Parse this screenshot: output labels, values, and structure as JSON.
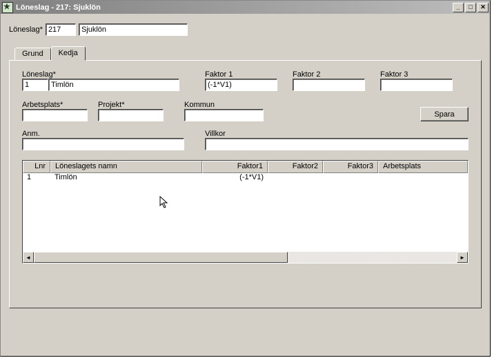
{
  "window": {
    "title": "Löneslag - 217: Sjuklön"
  },
  "header": {
    "loneslag_label": "Löneslag*",
    "loneslag_code": "217",
    "loneslag_name": "Sjuklön"
  },
  "tabs": {
    "grund": "Grund",
    "kedja": "Kedja"
  },
  "kedja": {
    "loneslag_label": "Löneslag*",
    "loneslag_code": "1",
    "loneslag_name": "Timlön",
    "faktor1_label": "Faktor 1",
    "faktor1_value": "(-1*V1)",
    "faktor2_label": "Faktor 2",
    "faktor2_value": "",
    "faktor3_label": "Faktor 3",
    "faktor3_value": "",
    "arbetsplats_label": "Arbetsplats*",
    "arbetsplats_value": "",
    "projekt_label": "Projekt*",
    "projekt_value": "",
    "kommun_label": "Kommun",
    "kommun_value": "",
    "spara_label": "Spara",
    "anm_label": "Anm.",
    "anm_value": "",
    "villkor_label": "Villkor",
    "villkor_value": ""
  },
  "table": {
    "headers": {
      "lnr": "Lnr",
      "namn": "Löneslagets namn",
      "faktor1": "Faktor1",
      "faktor2": "Faktor2",
      "faktor3": "Faktor3",
      "arbetsplats": "Arbetsplats"
    },
    "rows": [
      {
        "lnr": "1",
        "namn": "Timlön",
        "faktor1": "(-1*V1)",
        "faktor2": "",
        "faktor3": "",
        "arbetsplats": ""
      }
    ]
  }
}
